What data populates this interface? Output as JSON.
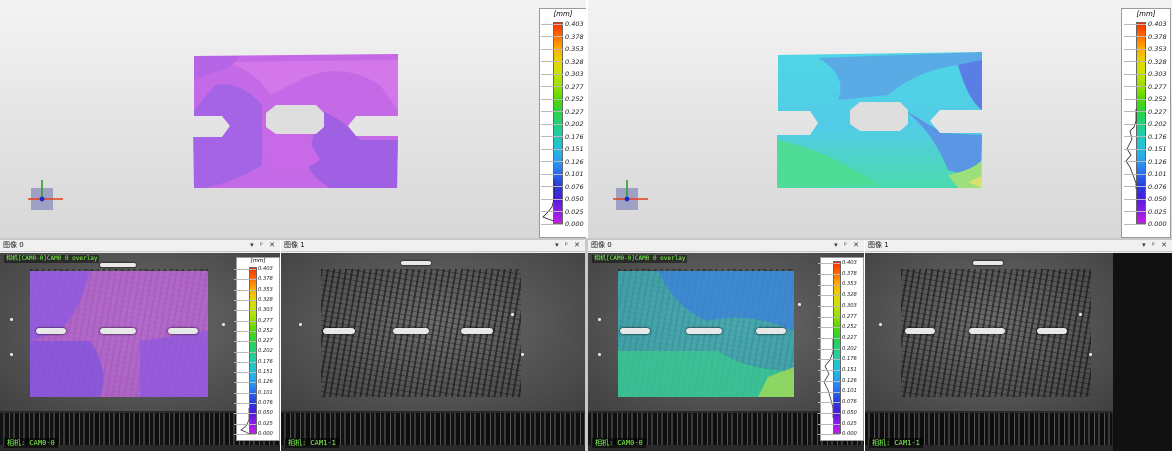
{
  "legend": {
    "unit": "[mm]",
    "ticks": [
      "0.403",
      "0.378",
      "0.353",
      "0.328",
      "0.303",
      "0.277",
      "0.252",
      "0.227",
      "0.202",
      "0.176",
      "0.151",
      "0.126",
      "0.101",
      "0.076",
      "0.050",
      "0.025",
      "0.000"
    ],
    "colors": [
      "#ff2a00",
      "#ff6a00",
      "#ffaa00",
      "#e8d400",
      "#c8e400",
      "#9be000",
      "#5ad800",
      "#2ed23a",
      "#22d27a",
      "#22ccb0",
      "#22c0e0",
      "#2aa0f0",
      "#2a6ef0",
      "#2a3ce0",
      "#4a1ce0",
      "#8a1ce6",
      "#c21ee6"
    ]
  },
  "viewports": [
    {
      "name": "left-3d-view"
    },
    {
      "name": "right-3d-view"
    }
  ],
  "panes": [
    {
      "title": "图像 0",
      "controls": "▾ ᵖ ✕",
      "top_label": "相机[CAM0-0]CAM0 0 overlay",
      "camera": "相机: CAM0-0"
    },
    {
      "title": "图像 1",
      "controls": "▾ ᵖ ✕",
      "camera": "相机: CAM1-1"
    },
    {
      "title": "图像 0",
      "controls": "▾ ᵖ ✕",
      "top_label": "相机[CAM0-0]CAM0 0 overlay",
      "camera": "相机: CAM0-0"
    },
    {
      "title": "图像 1",
      "controls": "▾ ᵖ ✕",
      "camera": "相机: CAM1-1"
    }
  ]
}
